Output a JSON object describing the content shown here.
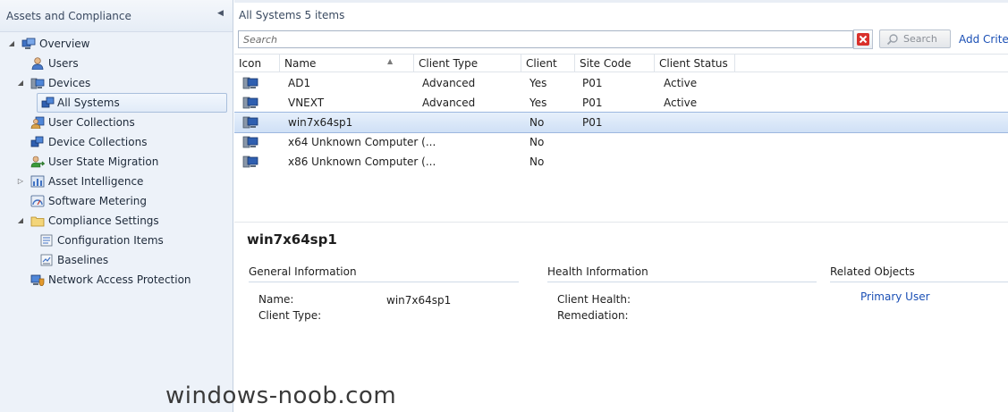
{
  "nav": {
    "title": "Assets and Compliance",
    "items": [
      {
        "label": "Overview",
        "icon": "overview-icon"
      },
      {
        "label": "Users",
        "icon": "user-icon"
      },
      {
        "label": "Devices",
        "icon": "devices-icon"
      },
      {
        "label": "All Systems",
        "icon": "systems-icon"
      },
      {
        "label": "User Collections",
        "icon": "user-collection-icon"
      },
      {
        "label": "Device Collections",
        "icon": "device-collection-icon"
      },
      {
        "label": "User State Migration",
        "icon": "migration-icon"
      },
      {
        "label": "Asset Intelligence",
        "icon": "asset-intelligence-icon"
      },
      {
        "label": "Software Metering",
        "icon": "metering-icon"
      },
      {
        "label": "Compliance Settings",
        "icon": "folder-icon"
      },
      {
        "label": "Configuration Items",
        "icon": "configuration-icon"
      },
      {
        "label": "Baselines",
        "icon": "baseline-icon"
      },
      {
        "label": "Network Access Protection",
        "icon": "nap-icon"
      }
    ]
  },
  "list": {
    "title": "All Systems 5 items",
    "search_placeholder": "Search",
    "search_button": "Search",
    "add_criteria": "Add Criteria",
    "columns": [
      "Icon",
      "Name",
      "Client Type",
      "Client",
      "Site Code",
      "Client Status"
    ],
    "rows": [
      {
        "name": "AD1",
        "client_type": "Advanced",
        "client": "Yes",
        "site_code": "P01",
        "status": "Active"
      },
      {
        "name": "VNEXT",
        "client_type": "Advanced",
        "client": "Yes",
        "site_code": "P01",
        "status": "Active"
      },
      {
        "name": "win7x64sp1",
        "client_type": "",
        "client": "No",
        "site_code": "P01",
        "status": ""
      },
      {
        "name": "x64 Unknown Computer (...",
        "client_type": "",
        "client": "No",
        "site_code": "",
        "status": ""
      },
      {
        "name": "x86 Unknown Computer (...",
        "client_type": "",
        "client": "No",
        "site_code": "",
        "status": ""
      }
    ],
    "selected_row": 2
  },
  "detail": {
    "title": "win7x64sp1",
    "general": {
      "heading": "General Information",
      "name_label": "Name:",
      "name_value": "win7x64sp1",
      "client_type_label": "Client Type:"
    },
    "health": {
      "heading": "Health Information",
      "client_health_label": "Client Health:",
      "remediation_label": "Remediation:"
    },
    "related": {
      "heading": "Related Objects",
      "primary_user": "Primary User"
    }
  },
  "watermark": "windows-noob.com",
  "colors": {
    "accent_link": "#1a4fb5",
    "selection": "#cfe0f6",
    "nav_bg": "#edf2f9"
  }
}
